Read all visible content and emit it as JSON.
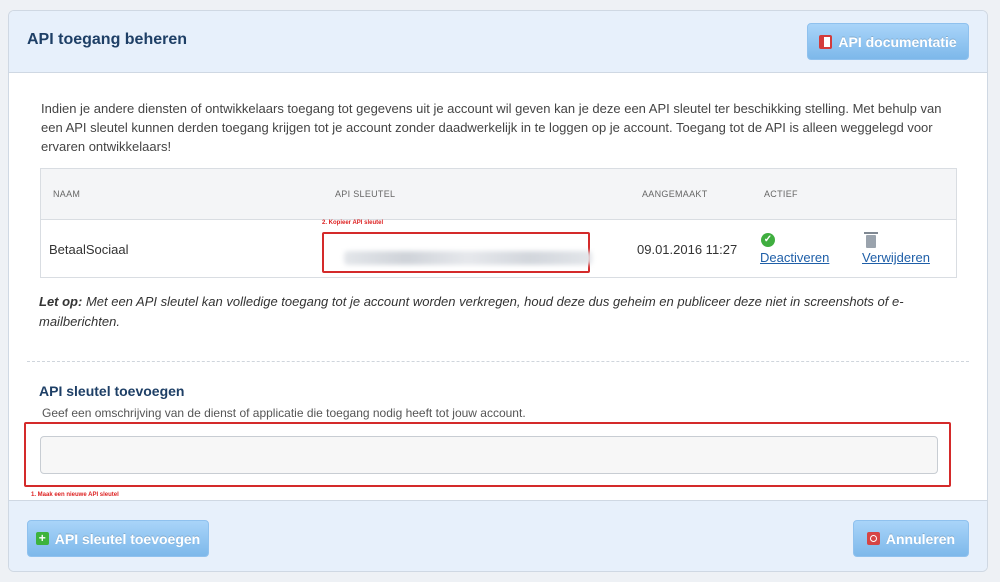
{
  "header": {
    "title": "API toegang beheren",
    "docs_button": "API documentatie"
  },
  "intro": "Indien je andere diensten of ontwikkelaars toegang tot gegevens uit je account wil geven kan je deze een API sleutel ter beschikking stelling. Met behulp van een API sleutel kunnen derden toegang krijgen tot je account zonder daadwerkelijk in te loggen op je account. Toegang tot de API is alleen weggelegd voor ervaren ontwikkelaars!",
  "table": {
    "columns": [
      "NAAM",
      "API SLEUTEL",
      "AANGEMAAKT",
      "ACTIEF"
    ],
    "rows": [
      {
        "name": "BetaalSociaal",
        "created": "09.01.2016 11:27",
        "active_action": "Deactiveren",
        "delete_action": "Verwijderen"
      }
    ],
    "copy_hint": "2. Kopieer API sleutel"
  },
  "warning": {
    "prefix": "Let op:",
    "text": " Met een API sleutel kan volledige toegang tot je account worden verkregen, houd deze dus geheim en publiceer deze niet in screenshots of e-mailberichten."
  },
  "add_section": {
    "title": "API sleutel toevoegen",
    "description": "Geef een omschrijving van de dienst of applicatie die toegang nodig heeft tot jouw account.",
    "input_value": "",
    "create_hint": "1. Maak een nieuwe API sleutel"
  },
  "footer": {
    "add_button": "API sleutel toevoegen",
    "cancel_button": "Annuleren"
  },
  "colors": {
    "accent": "#7db8ea",
    "annotation": "#d42a2a",
    "active": "#3fae3f"
  }
}
